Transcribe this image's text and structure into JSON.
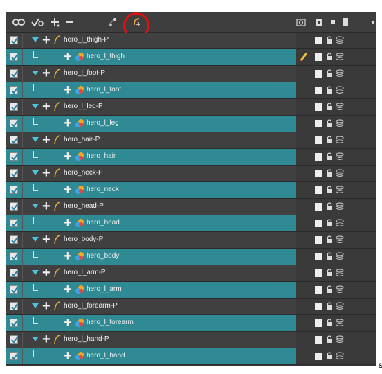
{
  "toolbar": {
    "icons": [
      "onion-skin-icon",
      "enable-disable-icon",
      "add-layer-icon",
      "delete-layer-icon",
      "add-peg-icon",
      "add-drawing-peg-icon"
    ],
    "right_icons": [
      "camera-icon",
      "display-icon",
      "color-swatch-icon",
      "lock-column-icon"
    ],
    "highlight_color": "#e01010"
  },
  "layers": [
    {
      "name": "hero_l_thigh-P",
      "type": "peg",
      "enabled": true
    },
    {
      "name": "hero_l_thigh",
      "type": "drawing",
      "enabled": true,
      "editing": true
    },
    {
      "name": "hero_l_foot-P",
      "type": "peg",
      "enabled": true
    },
    {
      "name": "hero_l_foot",
      "type": "drawing",
      "enabled": true
    },
    {
      "name": "hero_l_leg-P",
      "type": "peg",
      "enabled": true
    },
    {
      "name": "hero_l_leg",
      "type": "drawing",
      "enabled": true
    },
    {
      "name": "hero_hair-P",
      "type": "peg",
      "enabled": true
    },
    {
      "name": "hero_hair",
      "type": "drawing",
      "enabled": true
    },
    {
      "name": "hero_neck-P",
      "type": "peg",
      "enabled": true
    },
    {
      "name": "hero_neck",
      "type": "drawing",
      "enabled": true
    },
    {
      "name": "hero_head-P",
      "type": "peg",
      "enabled": true
    },
    {
      "name": "hero_head",
      "type": "drawing",
      "enabled": true
    },
    {
      "name": "hero_body-P",
      "type": "peg",
      "enabled": true
    },
    {
      "name": "hero_body",
      "type": "drawing",
      "enabled": true
    },
    {
      "name": "hero_l_arm-P",
      "type": "peg",
      "enabled": true
    },
    {
      "name": "hero_l_arm",
      "type": "drawing",
      "enabled": true
    },
    {
      "name": "hero_l_forearm-P",
      "type": "peg",
      "enabled": true
    },
    {
      "name": "hero_l_forearm",
      "type": "drawing",
      "enabled": true
    },
    {
      "name": "hero_l_hand-P",
      "type": "peg",
      "enabled": true
    },
    {
      "name": "hero_l_hand",
      "type": "drawing",
      "enabled": true
    }
  ],
  "colors": {
    "peg_row": "#404040",
    "drawing_row": "#2f8a94",
    "peg_arrow": "#4fc3d9"
  },
  "stray_text": "s"
}
